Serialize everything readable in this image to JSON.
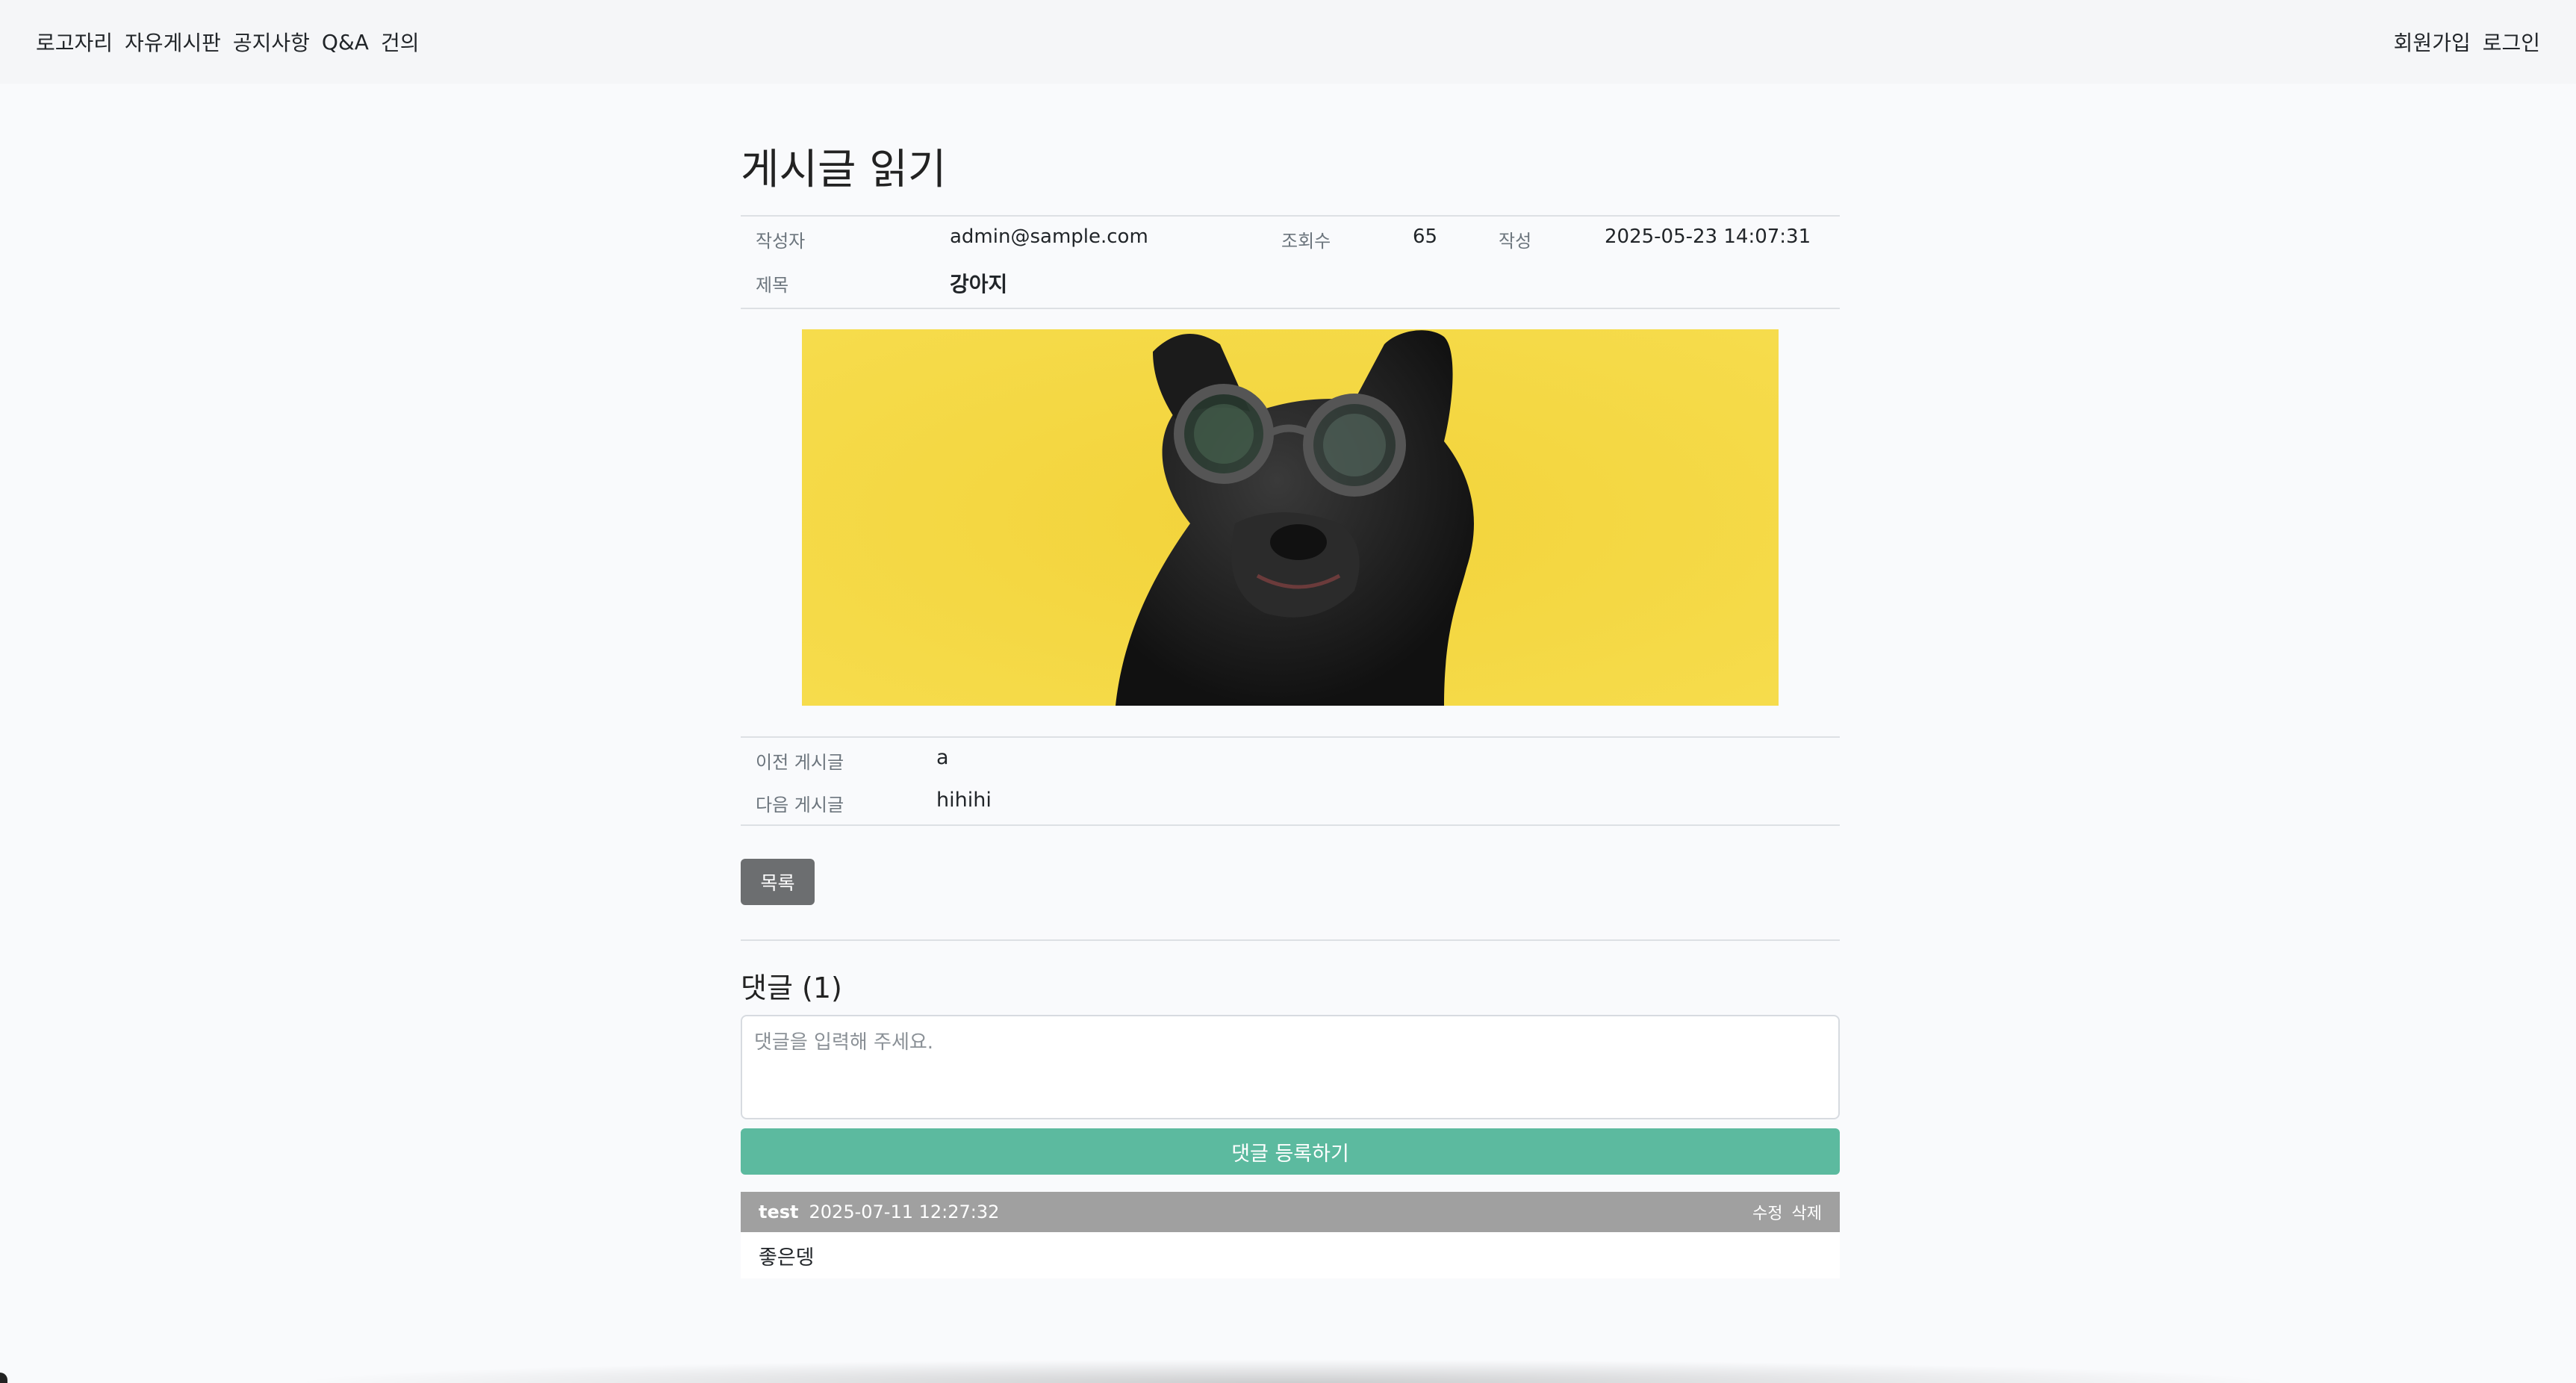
{
  "nav": {
    "left": [
      "로고자리",
      "자유게시판",
      "공지사항",
      "Q&A",
      "건의"
    ],
    "right": [
      "회원가입",
      "로그인"
    ]
  },
  "page_title": "게시글 읽기",
  "post": {
    "author_label": "작성자",
    "author": "admin@sample.com",
    "views_label": "조회수",
    "views": "65",
    "date_label": "작성",
    "date": "2025-05-23 14:07:31",
    "title_label": "제목",
    "title": "강아지"
  },
  "image_subject": "black french bulldog wearing round glasses on yellow background",
  "adjacent": {
    "prev_label": "이전 게시글",
    "prev": "a",
    "next_label": "다음 게시글",
    "next": "hihihi"
  },
  "list_button": "목록",
  "comments": {
    "title": "댓글 (1)",
    "placeholder": "댓글을 입력해 주세요.",
    "submit": "댓글 등록하기",
    "items": [
      {
        "author": "test",
        "date": "2025-07-11 12:27:32",
        "edit": "수정",
        "delete": "삭제",
        "body": "좋은뎅"
      }
    ]
  }
}
